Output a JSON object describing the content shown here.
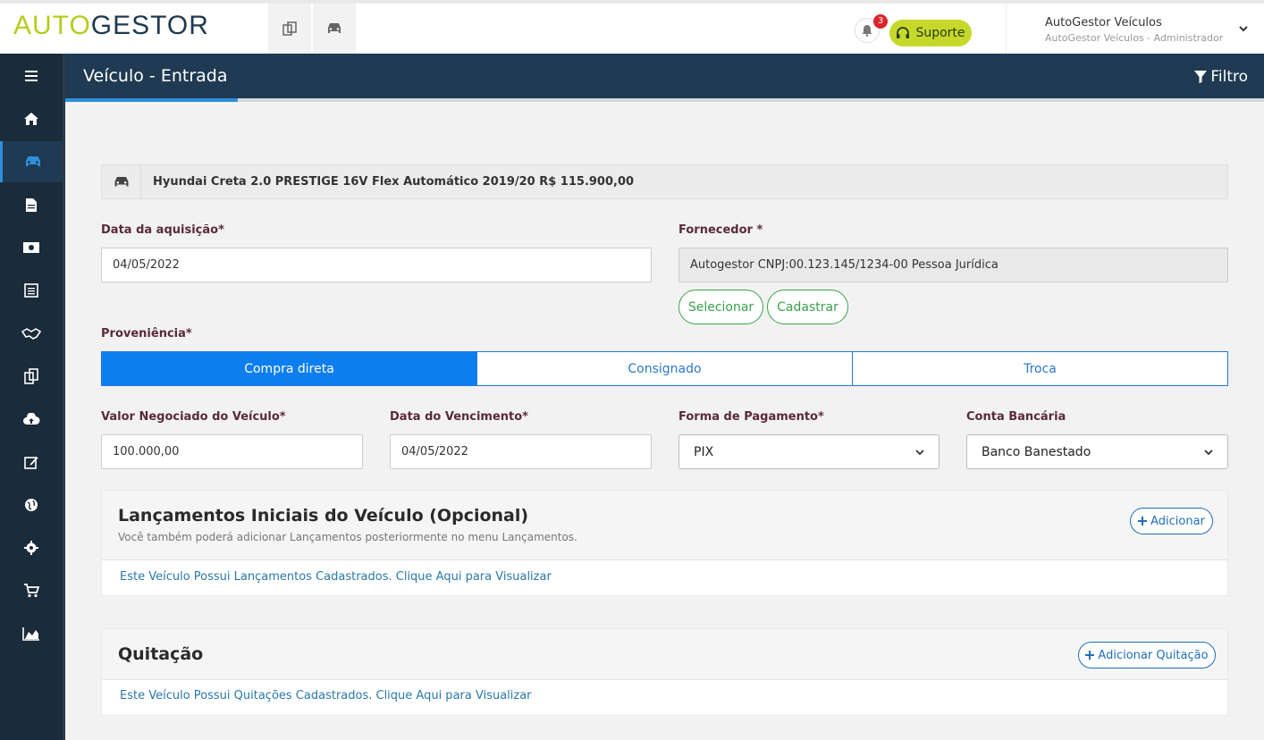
{
  "brand": {
    "part1": "AUTO",
    "part2": "GESTOR"
  },
  "topbar": {
    "notifications_count": "3",
    "support_label": "Suporte",
    "user_name": "AutoGestor Veículos",
    "user_role": "AutoGestor Veículos - Administrador"
  },
  "page": {
    "title": "Veículo - Entrada",
    "filter_label": "Filtro"
  },
  "vehicle": {
    "description": "Hyundai Creta 2.0 PRESTIGE 16V Flex Automático 2019/20 R$ 115.900,00"
  },
  "form": {
    "acquisition_date_label": "Data da aquisição*",
    "acquisition_date_value": "04/05/2022",
    "supplier_label": "Fornecedor *",
    "supplier_value": "Autogestor CNPJ:00.123.145/1234-00 Pessoa Jurídica",
    "select_label": "Selecionar",
    "register_label": "Cadastrar",
    "origin_label": "Proveniência*",
    "origin_options": [
      "Compra direta",
      "Consignado",
      "Troca"
    ],
    "negotiated_value_label": "Valor Negociado do Veículo*",
    "negotiated_value": "100.000,00",
    "due_date_label": "Data do Vencimento*",
    "due_date_value": "04/05/2022",
    "payment_method_label": "Forma de Pagamento*",
    "payment_method_value": "PIX",
    "bank_account_label": "Conta Bancária",
    "bank_account_value": "Banco Banestado"
  },
  "entries_panel": {
    "title": "Lançamentos Iniciais do Veículo (Opcional)",
    "subtitle": "Você também poderá adicionar Lançamentos posteriormente no menu Lançamentos.",
    "add_label": "Adicionar",
    "link": "Este Veículo Possui Lançamentos Cadastrados. Clique Aqui para Visualizar"
  },
  "settlement_panel": {
    "title": "Quitação",
    "add_label": "Adicionar Quitação",
    "link": "Este Veículo Possui Quitações Cadastrados. Clique Aqui para Visualizar"
  },
  "icons": {
    "sidebar": [
      "menu-icon",
      "home-icon",
      "car-icon",
      "document-icon",
      "money-icon",
      "receipt-icon",
      "handshake-icon",
      "copy-icon",
      "upload-cloud-icon",
      "edit-icon",
      "globe-icon",
      "gear-icon",
      "cart-icon",
      "area-chart-icon"
    ]
  },
  "colors": {
    "sidebar": "#1a2b3a",
    "header": "#1f3a52",
    "accent": "#0d7ef0",
    "brand_green": "#b5cc1a",
    "success": "#3aa14a"
  }
}
